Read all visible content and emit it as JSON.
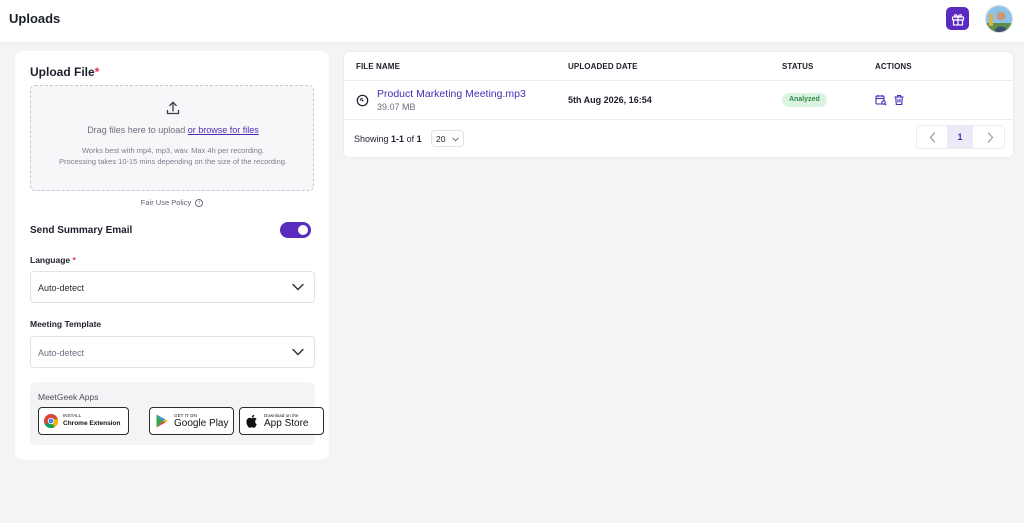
{
  "header": {
    "title": "Uploads",
    "gift_icon": "gift-icon",
    "avatar_icon": "user-avatar"
  },
  "upload": {
    "title": "Upload File",
    "required_mark": "*",
    "drop_text": "Drag files here to upload",
    "browse_link": "or browse for files",
    "hint_line1": "Works best with mp4, mp3, wav. Max 4h per recording.",
    "hint_line2": "Processing takes 10-15 mins depending on the size of the recording.",
    "fair_use": "Fair Use Policy"
  },
  "settings": {
    "send_summary_label": "Send Summary Email",
    "send_summary_enabled": true,
    "language_label": "Language",
    "language_required": "*",
    "language_value": "Auto-detect",
    "template_label": "Meeting Template",
    "template_value": "Auto-detect"
  },
  "apps": {
    "title": "MeetGeek Apps",
    "chrome_small": "INSTALL",
    "chrome_big": "Chrome Extension",
    "gplay_small": "GET IT ON",
    "gplay_big": "Google Play",
    "apple_small": "Download on the",
    "apple_big": "App Store"
  },
  "table": {
    "columns": [
      "FILE NAME",
      "UPLOADED DATE",
      "STATUS",
      "ACTIONS"
    ],
    "rows": [
      {
        "file_name": "Product Marketing Meeting.mp3",
        "file_size": "39.07 MB",
        "uploaded_date": "5th Aug 2026, 16:54",
        "status": "Analyzed"
      }
    ]
  },
  "pagination": {
    "showing_prefix": "Showing",
    "range": "1-1",
    "of_text": "of",
    "total": "1",
    "per_page": "20",
    "current_page": "1"
  },
  "colors": {
    "accent": "#5a2bbf",
    "link": "#4a2bb5",
    "status_bg": "#dcf3e2",
    "status_text": "#2f8a49"
  }
}
